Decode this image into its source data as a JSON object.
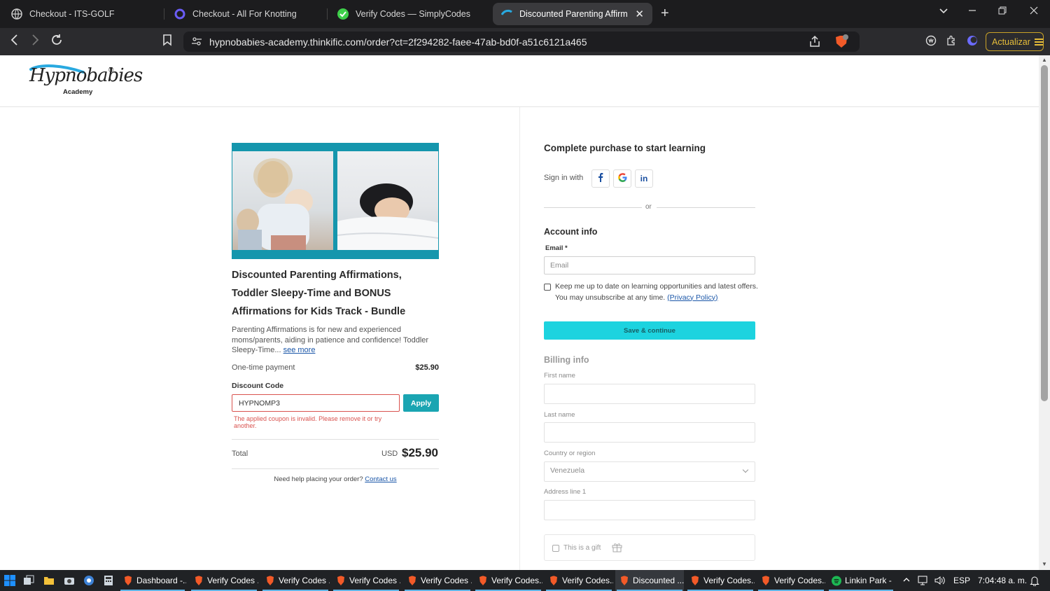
{
  "browser": {
    "tabs": [
      {
        "label": "Checkout - ITS-GOLF",
        "icon": "globe-icon",
        "active": false
      },
      {
        "label": "Checkout - All For Knotting",
        "icon": "knot-icon",
        "active": false
      },
      {
        "label": "Verify Codes — SimplyCodes",
        "icon": "simplycodes-icon",
        "active": false
      },
      {
        "label": "Discounted Parenting Affirmatio",
        "icon": "thinkific-icon",
        "active": true
      }
    ],
    "url": "hypnobabies-academy.thinkific.com/order?ct=2f294282-faee-47ab-bd0f-a51c6121a465",
    "update_label": "Actualizar",
    "brave_badge": "3"
  },
  "site": {
    "logo_text": "Hypnobabies",
    "logo_sub": "Academy",
    "logo_reg": "®"
  },
  "product": {
    "title": "Discounted Parenting Affirmations, Toddler Sleepy-Time and BONUS Affirmations for Kids Track - Bundle",
    "description": "Parenting Affirmations is for new and experienced moms/parents, aiding in patience and confidence! Toddler Sleepy-Time...",
    "see_more": "see more",
    "payment_label": "One-time payment",
    "payment_price": "$25.90",
    "discount_label": "Discount Code",
    "discount_value": "HYPNOMP3",
    "apply_label": "Apply",
    "discount_error": "The applied coupon is invalid. Please remove it or try another.",
    "total_label": "Total",
    "total_currency": "USD",
    "total_amount": "$25.90",
    "help_text": "Need help placing your order?",
    "contact_link": "Contact us"
  },
  "checkout": {
    "title": "Complete purchase to start learning",
    "sign_in_label": "Sign in with",
    "or_label": "or",
    "account_title": "Account info",
    "email_label": "Email *",
    "email_placeholder": "Email",
    "keep_text": "Keep me up to date on learning opportunities and latest offers. You may unsubscribe at any time.",
    "privacy_link": "(Privacy Policy)",
    "save_label": "Save & continue",
    "billing_title": "Billing info",
    "first_name_label": "First name",
    "last_name_label": "Last name",
    "country_label": "Country or region",
    "country_value": "Venezuela",
    "address_label": "Address line 1",
    "gift_label": "This is a gift"
  },
  "taskbar": {
    "items": [
      {
        "label": "Dashboard -..."
      },
      {
        "label": "Verify Codes ..."
      },
      {
        "label": "Verify Codes ..."
      },
      {
        "label": "Verify Codes ..."
      },
      {
        "label": "Verify Codes ..."
      },
      {
        "label": "Verify Codes..."
      },
      {
        "label": "Verify Codes..."
      },
      {
        "label": "Discounted ..."
      },
      {
        "label": "Verify Codes..."
      },
      {
        "label": "Verify Codes..."
      },
      {
        "label": "Linkin Park - ..."
      }
    ],
    "lang": "ESP",
    "time": "7:04:48 a. m."
  },
  "colors": {
    "accent_teal": "#1aa5b2",
    "save_button": "#1dd3df",
    "error": "#d9534f",
    "update_gold": "#e6bd3a"
  }
}
